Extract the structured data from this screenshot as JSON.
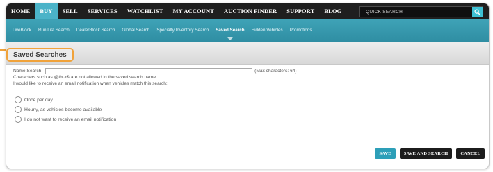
{
  "topnav": {
    "items": [
      "HOME",
      "BUY",
      "SELL",
      "SERVICES",
      "WATCHLIST",
      "MY ACCOUNT",
      "AUCTION FINDER",
      "SUPPORT",
      "BLOG"
    ],
    "active_index": 1,
    "search_placeholder": "QUICK SEARCH",
    "search_icon": "search-icon"
  },
  "subnav": {
    "items": [
      "LiveBlock",
      "Run List Search",
      "DealerBlock Search",
      "Global Search",
      "Specialty Inventory Search",
      "Saved Search",
      "Hidden Vehicles",
      "Promotions"
    ],
    "active_index": 5
  },
  "page": {
    "title": "Saved Searches"
  },
  "form": {
    "name_label": "Name Search:",
    "name_value": "",
    "max_chars": "(Max characters: 64)",
    "note": "Characters such as @#<>& are not allowed in the saved search name.",
    "email_prompt": "I would like to receive an email notification when vehicles match this search:",
    "options": [
      "Once per day",
      "Hourly, as vehicles become available",
      "I do not want to receive an email notification"
    ]
  },
  "actions": {
    "save": "SAVE",
    "save_and_search": "SAVE AND SEARCH",
    "cancel": "CANCEL"
  },
  "colors": {
    "accent": "#2d9fb8",
    "highlight": "#f0a23a",
    "nav_bg": "#1f1f1f"
  }
}
